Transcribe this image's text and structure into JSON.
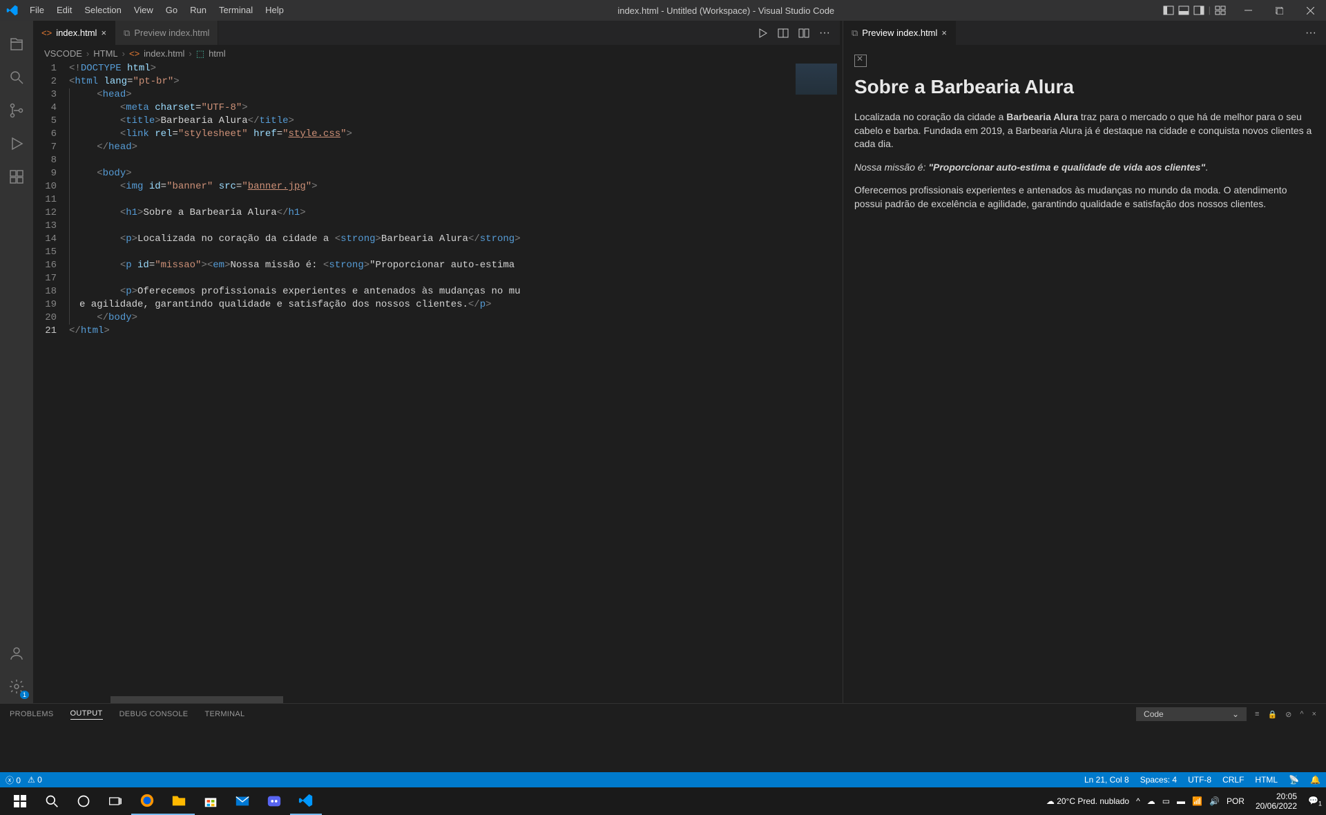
{
  "titleBar": {
    "menus": [
      "File",
      "Edit",
      "Selection",
      "View",
      "Go",
      "Run",
      "Terminal",
      "Help"
    ],
    "title": "index.html - Untitled (Workspace) - Visual Studio Code"
  },
  "tabs": {
    "left": [
      {
        "label": "index.html",
        "active": true,
        "closeable": true
      },
      {
        "label": "Preview index.html",
        "active": false,
        "closeable": false
      }
    ],
    "right": [
      {
        "label": "Preview index.html",
        "active": true,
        "closeable": true
      }
    ]
  },
  "breadcrumb": [
    "VSCODE",
    "HTML",
    "index.html",
    "html"
  ],
  "codeLines": 21,
  "panel": {
    "tabs": [
      "PROBLEMS",
      "OUTPUT",
      "DEBUG CONSOLE",
      "TERMINAL"
    ],
    "active": "OUTPUT",
    "dropdown": "Code"
  },
  "statusBar": {
    "errors": "0",
    "warnings": "0",
    "position": "Ln 21, Col 8",
    "spaces": "Spaces: 4",
    "encoding": "UTF-8",
    "eol": "CRLF",
    "lang": "HTML"
  },
  "preview": {
    "heading": "Sobre a Barbearia Alura",
    "p1_a": "Localizada no coração da cidade a ",
    "p1_strong": "Barbearia Alura",
    "p1_b": " traz para o mercado o que há de melhor para o seu cabelo e barba. Fundada em 2019, a Barbearia Alura já é destaque na cidade e conquista novos clientes a cada dia.",
    "p2_em_a": "Nossa missão é: ",
    "p2_strong": "\"Proporcionar auto-estima e qualidade de vida aos clientes\"",
    "p2_dot": ".",
    "p3": "Oferecemos profissionais experientes e antenados às mudanças no mundo da moda. O atendimento possui padrão de excelência e agilidade, garantindo qualidade e satisfação dos nossos clientes."
  },
  "taskbar": {
    "weather": "20°C  Pred. nublado",
    "time": "20:05",
    "date": "20/06/2022"
  },
  "code": {
    "l1": "<!DOCTYPE html>",
    "l2": "<html lang=\"pt-br\">",
    "l3": "<head>",
    "l4": "<meta charset=\"UTF-8\">",
    "l5a": "<title>",
    "l5b": "Barbearia Alura",
    "l5c": "</title>",
    "l6a": "<link rel=\"stylesheet\" href=\"",
    "l6b": "style.css",
    "l6c": "\">",
    "l7": "</head>",
    "l9": "<body>",
    "l10a": "<img id=\"banner\" src=\"",
    "l10b": "banner.jpg",
    "l10c": "\">",
    "l12a": "<h1>",
    "l12b": "Sobre a Barbearia Alura",
    "l12c": "</h1>",
    "l14a": "<p>",
    "l14b": "Localizada no coração da cidade a ",
    "l14c": "<strong>",
    "l14d": "Barbearia Alura",
    "l14e": "</strong>",
    "l16a": "<p id=\"missao\"><em>",
    "l16b": "Nossa missão é: ",
    "l16c": "<strong>",
    "l16d": "\"Proporcionar auto-estima",
    "l18a": "<p>",
    "l18b": "Oferecemos profissionais experientes e antenados às mudanças no mu",
    "l19a": "e agilidade, garantindo qualidade e satisfação dos nossos clientes.",
    "l19b": "</p>",
    "l20": "</body>",
    "l21": "</html>"
  }
}
